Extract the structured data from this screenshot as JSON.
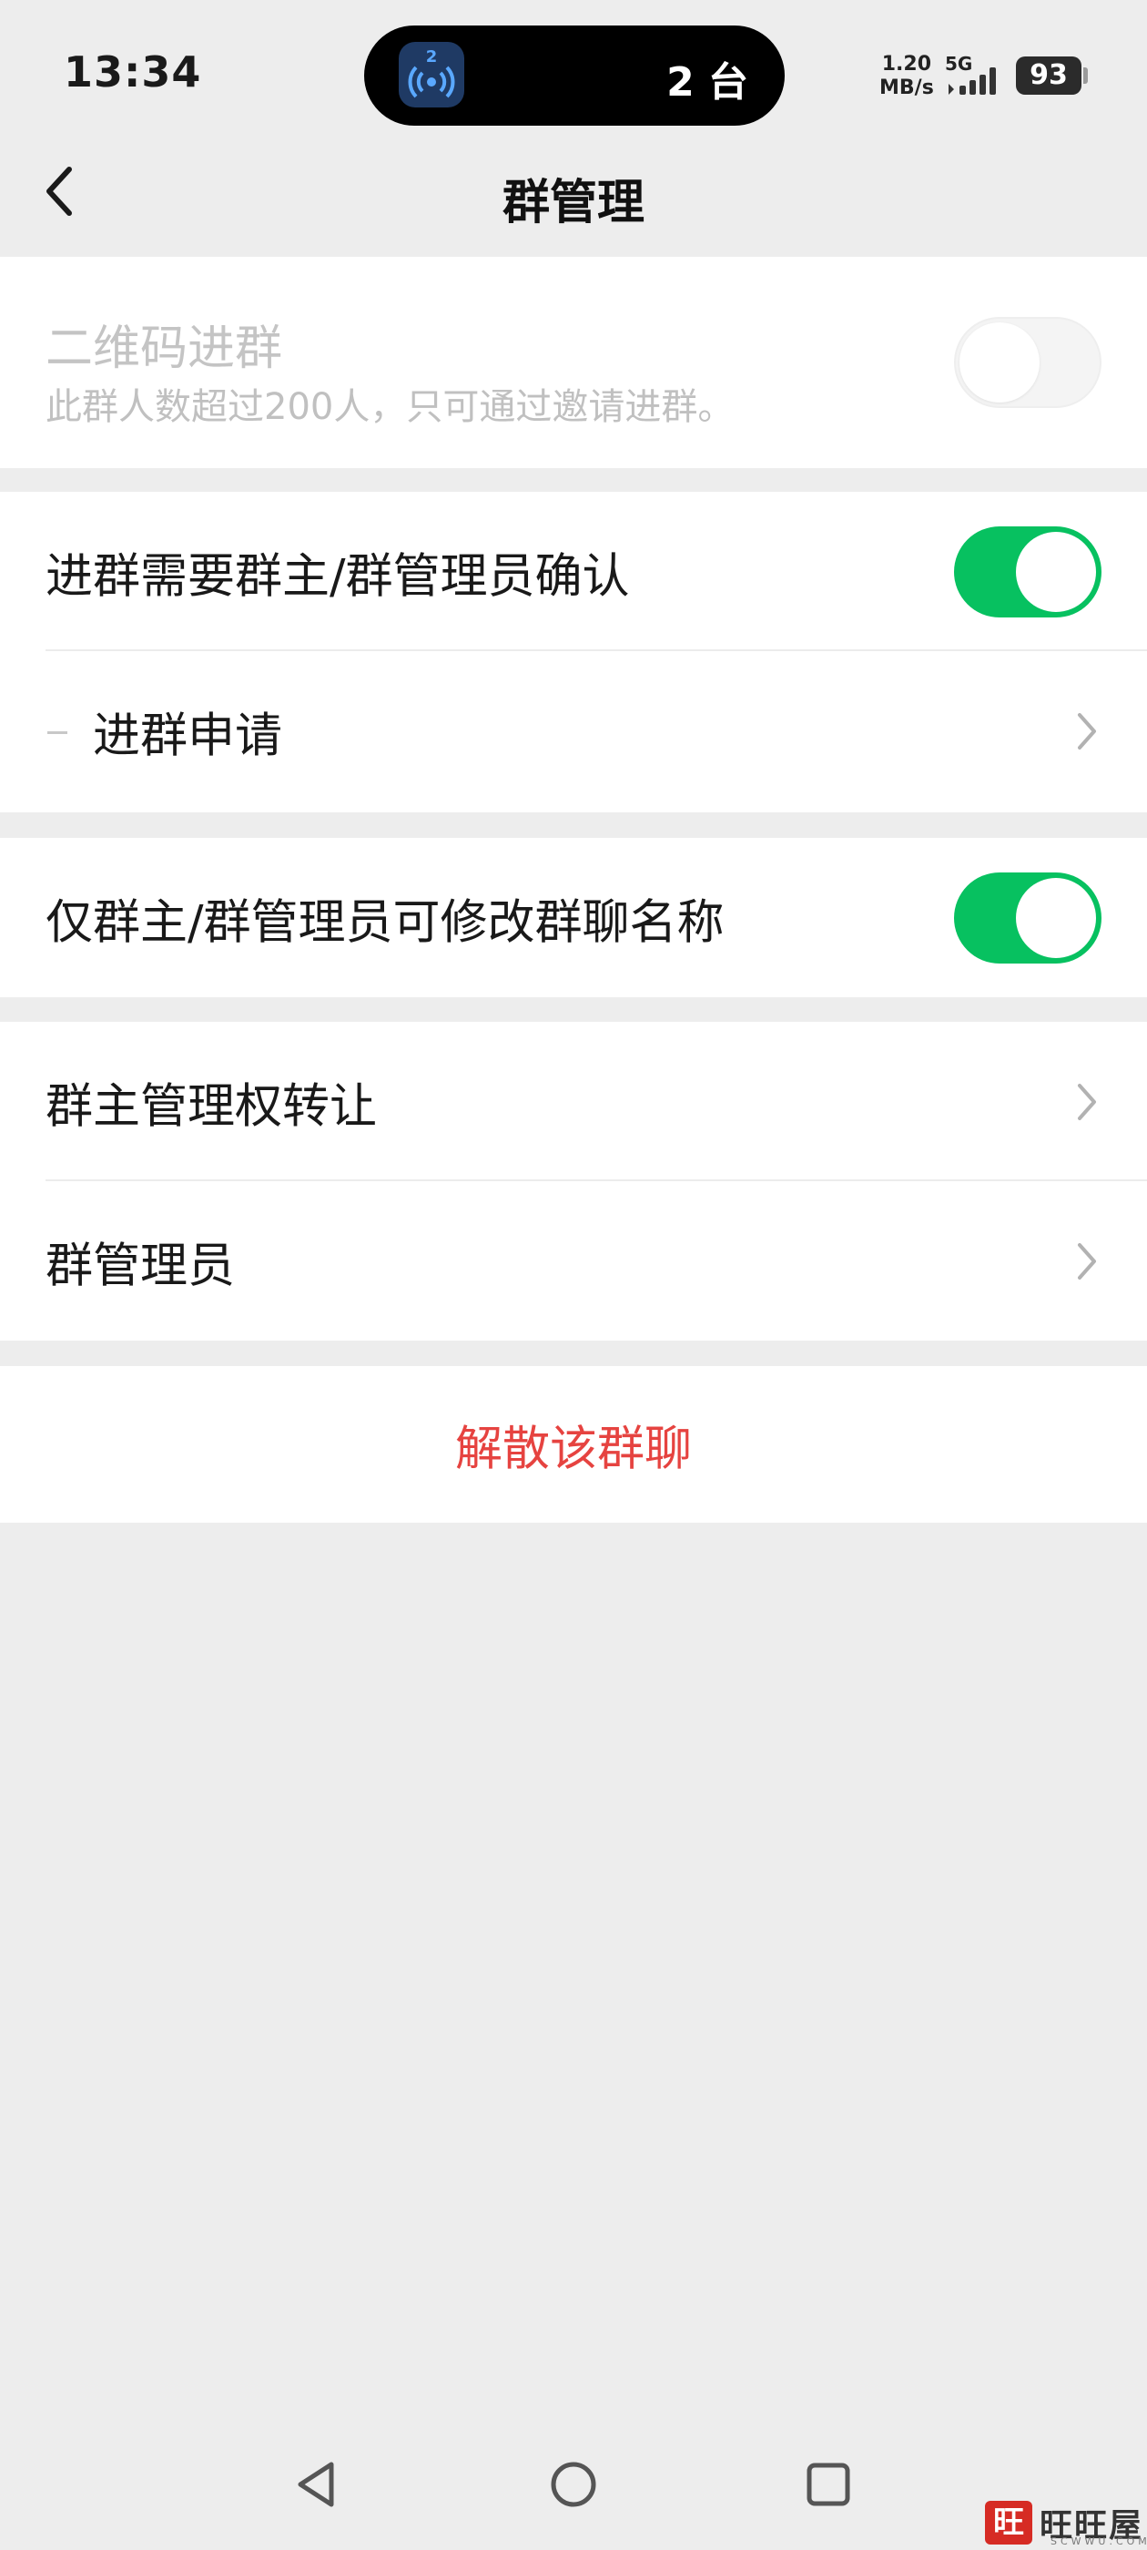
{
  "status_bar": {
    "time": "13:34",
    "island_badge": "2",
    "island_count": "2 台",
    "net_speed_value": "1.20",
    "net_speed_unit": "MB/s",
    "net_type": "5G",
    "battery": "93"
  },
  "nav": {
    "title": "群管理",
    "back_icon": "chevron-left-icon"
  },
  "qr_section": {
    "title": "二维码进群",
    "subtitle": "此群人数超过200人，只可通过邀请进群。",
    "toggle_on": false,
    "disabled": true
  },
  "confirm_section": {
    "toggle_label": "进群需要群主/群管理员确认",
    "toggle_on": true,
    "sub_item_label": "进群申请"
  },
  "rename_section": {
    "toggle_label": "仅群主/群管理员可修改群聊名称",
    "toggle_on": true
  },
  "admin_section": {
    "items": [
      {
        "label": "群主管理权转让"
      },
      {
        "label": "群管理员"
      }
    ]
  },
  "danger_section": {
    "label": "解散该群聊"
  },
  "watermark": {
    "seal": "旺",
    "text": "旺旺屋",
    "domain": "SCWWU.COM"
  },
  "colors": {
    "accent_green": "#07c160",
    "danger_red": "#e64340",
    "background": "#ededed"
  }
}
